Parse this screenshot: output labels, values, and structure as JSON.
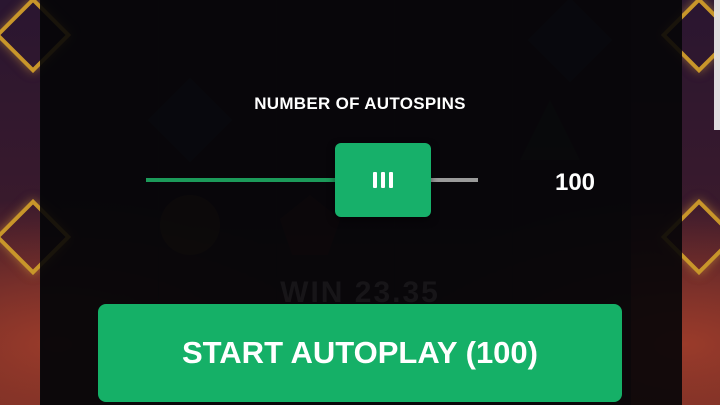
{
  "panel": {
    "title": "NUMBER OF AUTOSPINS"
  },
  "slider": {
    "value": "100",
    "fill_fraction": 0.6
  },
  "start_button": {
    "label": "START AUTOPLAY (100)"
  },
  "background": {
    "ghost_text": "WIN 23.35"
  },
  "colors": {
    "accent": "#15b067",
    "overlay": "#060608",
    "track": "#9a9a9a"
  }
}
